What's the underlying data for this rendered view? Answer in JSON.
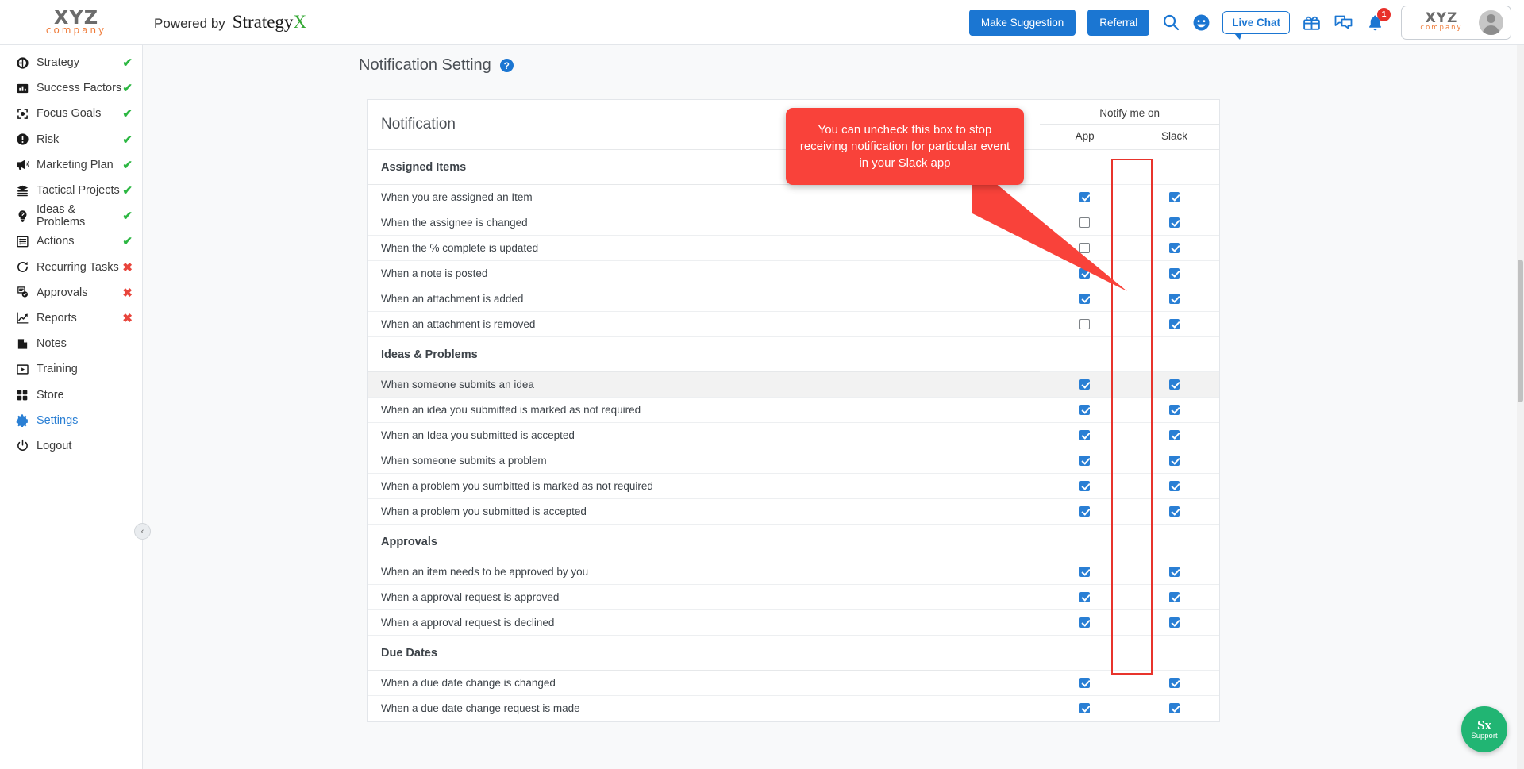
{
  "header": {
    "logo_primary": "XYZ",
    "logo_secondary": "company",
    "powered_by": "Powered by",
    "brand_main": "Strategy",
    "brand_accent": "X",
    "make_suggestion": "Make Suggestion",
    "referral": "Referral",
    "search_icon": "search-icon",
    "smiley_icon": "smiley-icon",
    "live_chat": "Live Chat",
    "gift_icon": "gift-icon",
    "messages_icon": "messages-icon",
    "bell_icon": "bell-icon",
    "notification_count": "1",
    "accent_blue": "#1b76d2",
    "badge_red": "#e8302a"
  },
  "sidebar": {
    "items": [
      {
        "label": "Strategy",
        "icon": "pie-chart-icon",
        "status": "ok",
        "mark": "✔",
        "active": false
      },
      {
        "label": "Success Factors",
        "icon": "bar-chart-icon",
        "status": "ok",
        "mark": "✔",
        "active": false
      },
      {
        "label": "Focus Goals",
        "icon": "target-icon",
        "status": "ok",
        "mark": "✔",
        "active": false
      },
      {
        "label": "Risk",
        "icon": "alert-icon",
        "status": "ok",
        "mark": "✔",
        "active": false
      },
      {
        "label": "Marketing Plan",
        "icon": "megaphone-icon",
        "status": "ok",
        "mark": "✔",
        "active": false
      },
      {
        "label": "Tactical Projects",
        "icon": "layers-icon",
        "status": "ok",
        "mark": "✔",
        "active": false
      },
      {
        "label": "Ideas & Problems",
        "icon": "lightbulb-icon",
        "status": "ok",
        "mark": "✔",
        "active": false
      },
      {
        "label": "Actions",
        "icon": "list-icon",
        "status": "ok",
        "mark": "✔",
        "active": false
      },
      {
        "label": "Recurring Tasks",
        "icon": "refresh-icon",
        "status": "no",
        "mark": "✖",
        "active": false
      },
      {
        "label": "Approvals",
        "icon": "approval-icon",
        "status": "no",
        "mark": "✖",
        "active": false
      },
      {
        "label": "Reports",
        "icon": "trend-up-icon",
        "status": "no",
        "mark": "✖",
        "active": false
      },
      {
        "label": "Notes",
        "icon": "note-icon",
        "status": "",
        "mark": "",
        "active": false
      },
      {
        "label": "Training",
        "icon": "video-icon",
        "status": "",
        "mark": "",
        "active": false
      },
      {
        "label": "Store",
        "icon": "grid-icon",
        "status": "",
        "mark": "",
        "active": false
      },
      {
        "label": "Settings",
        "icon": "gear-icon",
        "status": "",
        "mark": "",
        "active": true
      },
      {
        "label": "Logout",
        "icon": "power-icon",
        "status": "",
        "mark": "",
        "active": false
      }
    ],
    "collapse_icon": "‹"
  },
  "page": {
    "title": "Notification Setting",
    "help_icon_label": "?"
  },
  "table": {
    "col_notification": "Notification",
    "col_group": "Notify me on",
    "col_app": "App",
    "col_slack": "Slack",
    "sections": [
      {
        "title": "Assigned Items",
        "rows": [
          {
            "label": "When you are assigned an Item",
            "app": true,
            "slack": true,
            "highlight": false
          },
          {
            "label": "When the assignee is changed",
            "app": false,
            "slack": true,
            "highlight": false
          },
          {
            "label": "When the % complete is updated",
            "app": false,
            "slack": true,
            "highlight": false
          },
          {
            "label": "When a note is posted",
            "app": true,
            "slack": true,
            "highlight": false
          },
          {
            "label": "When an attachment is added",
            "app": true,
            "slack": true,
            "highlight": false
          },
          {
            "label": "When an attachment is removed",
            "app": false,
            "slack": true,
            "highlight": false
          }
        ]
      },
      {
        "title": "Ideas & Problems",
        "rows": [
          {
            "label": "When someone submits an idea",
            "app": true,
            "slack": true,
            "highlight": true
          },
          {
            "label": "When an idea you submitted is marked as not required",
            "app": true,
            "slack": true,
            "highlight": false
          },
          {
            "label": "When an Idea you submitted is accepted",
            "app": true,
            "slack": true,
            "highlight": false
          },
          {
            "label": "When someone submits a problem",
            "app": true,
            "slack": true,
            "highlight": false
          },
          {
            "label": "When a problem you sumbitted is marked as not required",
            "app": true,
            "slack": true,
            "highlight": false
          },
          {
            "label": "When a problem you submitted is accepted",
            "app": true,
            "slack": true,
            "highlight": false
          }
        ]
      },
      {
        "title": "Approvals",
        "rows": [
          {
            "label": "When an item needs to be approved by you",
            "app": true,
            "slack": true,
            "highlight": false
          },
          {
            "label": "When a approval request is approved",
            "app": true,
            "slack": true,
            "highlight": false
          },
          {
            "label": "When a approval request is declined",
            "app": true,
            "slack": true,
            "highlight": false
          }
        ]
      },
      {
        "title": "Due Dates",
        "rows": [
          {
            "label": "When a due date change is changed",
            "app": true,
            "slack": true,
            "highlight": false
          },
          {
            "label": "When a due date change request is made",
            "app": true,
            "slack": true,
            "highlight": false
          }
        ]
      }
    ]
  },
  "tooltip": {
    "text": "You can uncheck this box to stop receiving notification for particular event in your Slack app",
    "color": "#f9423a"
  },
  "support": {
    "logo": "Sx",
    "label": "Support",
    "color": "#21b573"
  }
}
